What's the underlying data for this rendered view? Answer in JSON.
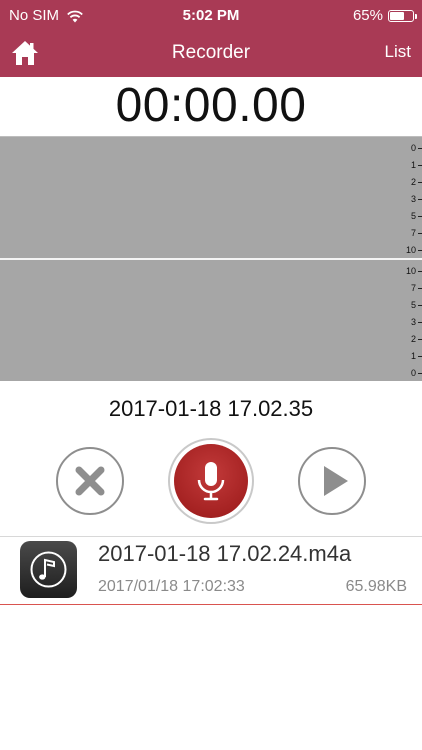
{
  "status_bar": {
    "carrier": "No SIM",
    "time": "5:02 PM",
    "battery": "65%",
    "battery_level": 0.65
  },
  "navbar": {
    "title": "Recorder",
    "list_label": "List",
    "home_icon": "home-icon"
  },
  "timer": "00:00.00",
  "meter_top": {
    "ticks": [
      "0",
      "1",
      "2",
      "3",
      "5",
      "7",
      "10"
    ]
  },
  "meter_bottom": {
    "ticks": [
      "10",
      "7",
      "5",
      "3",
      "2",
      "1",
      "0"
    ]
  },
  "recording_name": "2017-01-18 17.02.35",
  "controls": {
    "cancel_icon": "close-icon",
    "record_icon": "microphone-icon",
    "play_icon": "play-icon"
  },
  "files": [
    {
      "name": "2017-01-18 17.02.24.m4a",
      "date": "2017/01/18 17:02:33",
      "size": "65.98KB",
      "icon": "music-note-icon"
    }
  ],
  "colors": {
    "accent": "#a93a55",
    "record_red": "#b02a2a",
    "meter_gray": "#a6a6a6"
  }
}
